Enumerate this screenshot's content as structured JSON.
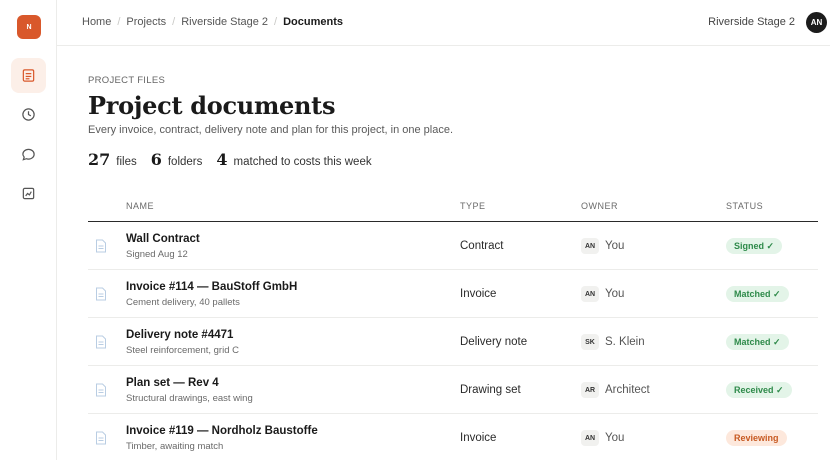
{
  "brand": {
    "logo_text": "N",
    "accent": "#d9582b"
  },
  "rail": {
    "items": [
      {
        "icon": "document-icon",
        "active": true
      },
      {
        "icon": "clock-icon",
        "active": false
      },
      {
        "icon": "chat-icon",
        "active": false
      },
      {
        "icon": "chart-icon",
        "active": false
      }
    ]
  },
  "breadcrumb": [
    "Home",
    "Projects",
    "Riverside Stage 2",
    "Documents"
  ],
  "header": {
    "project_name": "Riverside Stage 2",
    "avatar_initials": "AN"
  },
  "page": {
    "eyebrow": "PROJECT FILES",
    "title": "Project documents",
    "subtitle": "Every invoice, contract, delivery note and plan for this project, in one place."
  },
  "stats": [
    {
      "value": "27",
      "label": "files"
    },
    {
      "value": "6",
      "label": "folders"
    },
    {
      "value": "4",
      "label": "matched to costs this week"
    }
  ],
  "table": {
    "columns": [
      "NAME",
      "TYPE",
      "OWNER",
      "STATUS"
    ],
    "rows": [
      {
        "name": "Wall Contract",
        "sub": "Signed Aug 12",
        "type": "Contract",
        "owner_initials": "AN",
        "owner": "You",
        "status": "Signed ✓",
        "status_color": "green"
      },
      {
        "name": "Invoice #114 — BauStoff GmbH",
        "sub": "Cement delivery, 40 pallets",
        "type": "Invoice",
        "owner_initials": "AN",
        "owner": "You",
        "status": "Matched ✓",
        "status_color": "green"
      },
      {
        "name": "Delivery note #4471",
        "sub": "Steel reinforcement, grid C",
        "type": "Delivery note",
        "owner_initials": "SK",
        "owner": "S. Klein",
        "status": "Matched ✓",
        "status_color": "green"
      },
      {
        "name": "Plan set — Rev 4",
        "sub": "Structural drawings, east wing",
        "type": "Drawing set",
        "owner_initials": "AR",
        "owner": "Architect",
        "status": "Received ✓",
        "status_color": "green"
      },
      {
        "name": "Invoice #119 — Nordholz Baustoffe",
        "sub": "Timber, awaiting match",
        "type": "Invoice",
        "owner_initials": "AN",
        "owner": "You",
        "status": "Reviewing",
        "status_color": "orange"
      }
    ]
  }
}
